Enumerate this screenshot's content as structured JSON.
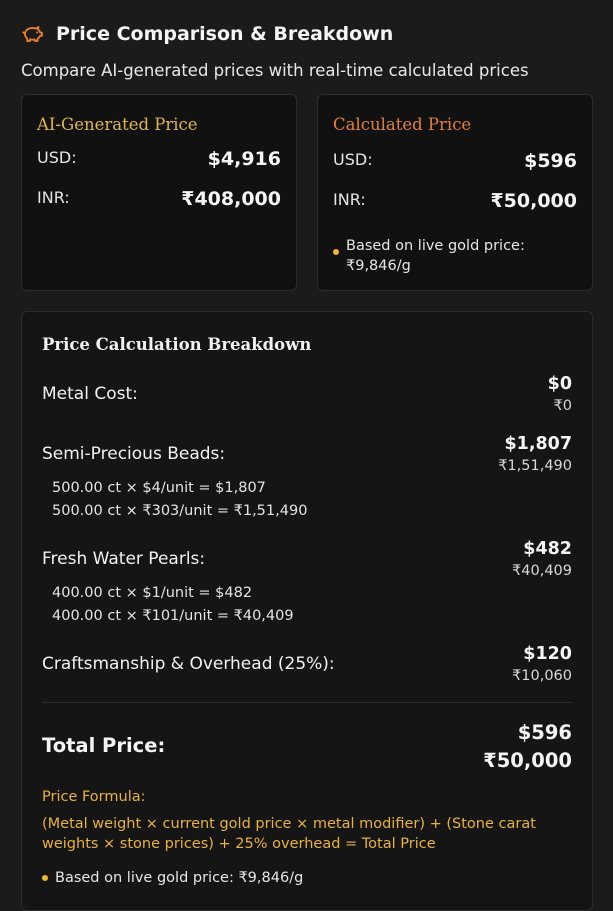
{
  "header": {
    "title": "Price Comparison & Breakdown",
    "subtitle": "Compare AI-generated prices with real-time calculated prices"
  },
  "ai_card": {
    "title": "AI-Generated Price",
    "usd_label": "USD:",
    "usd_value": "$4,916",
    "inr_label": "INR:",
    "inr_value": "₹408,000"
  },
  "calc_card": {
    "title": "Calculated Price",
    "usd_label": "USD:",
    "usd_value": "$596",
    "inr_label": "INR:",
    "inr_value": "₹50,000",
    "note": "Based on live gold price: ₹9,846/g"
  },
  "breakdown": {
    "title": "Price Calculation Breakdown",
    "items": [
      {
        "label": "Metal Cost:",
        "usd": "$0",
        "inr": "₹0",
        "details": []
      },
      {
        "label": "Semi-Precious Beads:",
        "usd": "$1,807",
        "inr": "₹1,51,490",
        "details": [
          "500.00 ct × $4/unit = $1,807",
          "500.00 ct × ₹303/unit = ₹1,51,490"
        ]
      },
      {
        "label": "Fresh Water Pearls:",
        "usd": "$482",
        "inr": "₹40,409",
        "details": [
          "400.00 ct × $1/unit = $482",
          "400.00 ct × ₹101/unit = ₹40,409"
        ]
      },
      {
        "label": "Craftsmanship & Overhead (25%):",
        "usd": "$120",
        "inr": "₹10,060",
        "details": []
      }
    ],
    "total_label": "Total Price:",
    "total_usd": "$596",
    "total_inr": "₹50,000",
    "formula_title": "Price Formula:",
    "formula_text": "(Metal weight × current gold price × metal modifier) + (Stone carat weights × stone prices) + 25% overhead = Total Price",
    "note": "Based on live gold price: ₹9,846/g"
  },
  "colors": {
    "accent_gold": "#e0b54e",
    "accent_orange": "#e0813a",
    "formula": "#e8b23c",
    "dot": "#f2b630"
  },
  "icons": {
    "header": "piggy-bank-icon"
  }
}
